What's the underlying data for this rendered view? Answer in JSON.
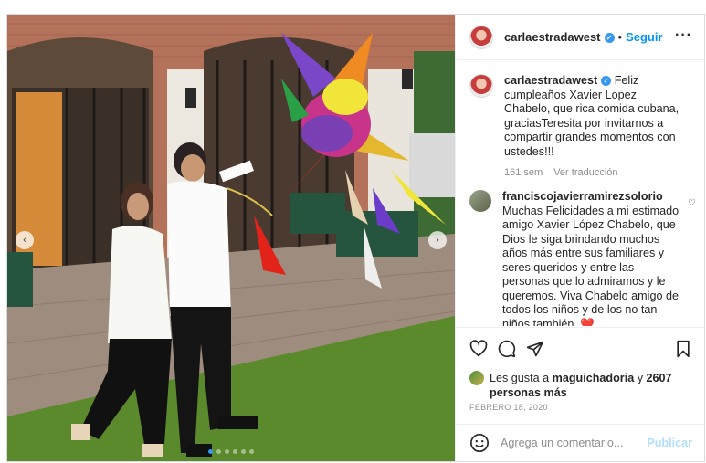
{
  "post": {
    "photo": {
      "alt": "",
      "carousel": {
        "count": 6,
        "active_index": 0
      },
      "prev_arrow": "‹",
      "next_arrow": "›"
    },
    "header": {
      "username": "carlaestradawest",
      "verified_icon": "verified-badge-icon",
      "separator": "•",
      "follow_label": "Seguir",
      "more_label": "···"
    },
    "caption": {
      "username": "carlaestradawest",
      "text": "Feliz cumpleaños Xavier Lopez Chabelo, que rica comida cubana, graciasTeresita por invitarnos a compartir grandes momentos con ustedes!!!",
      "age": "161 sem",
      "translate_label": "Ver traducción"
    },
    "comments": [
      {
        "username": "franciscojavierramirezsolorio",
        "text": "Muchas Felicidades a mi estimado amigo Xavier López Chabelo, que Dios le siga brindando muchos años más entre sus familiares y seres queridos y entre las personas que lo admiramos y le queremos. Viva Chabelo amigo de todos los niños y de los no tan niños también.",
        "emoji": "❤️"
      }
    ],
    "likes": {
      "prefix": "Les gusta a",
      "user": "maguichadoria",
      "conjunction": "y",
      "count": "2607",
      "suffix": "personas más"
    },
    "date": "FEBRERO 18, 2020",
    "add_comment": {
      "emoji_icon": "emoji-smile-icon",
      "placeholder": "Agrega un comentario...",
      "publish_label": "Publicar"
    }
  },
  "colors": {
    "accent": "#0095f6",
    "verified": "#3897f0",
    "muted": "#8e8e8e",
    "publish_disabled": "#b2dffc",
    "border": "#dbdbdb"
  }
}
